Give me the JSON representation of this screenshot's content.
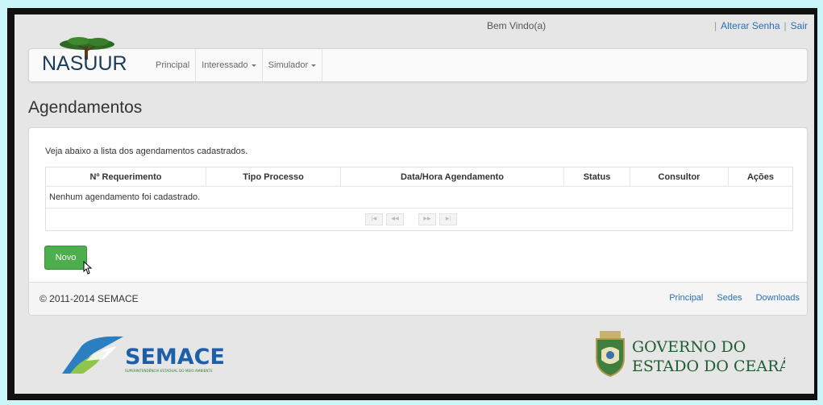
{
  "header": {
    "welcome": "Bem Vindo(a)",
    "links": [
      "Alterar Senha",
      "Sair"
    ]
  },
  "logo": {
    "text": "NASUUR"
  },
  "nav": {
    "items": [
      {
        "label": "Principal",
        "dropdown": false
      },
      {
        "label": "Interessado",
        "dropdown": true
      },
      {
        "label": "Simulador",
        "dropdown": true
      }
    ]
  },
  "page": {
    "title": "Agendamentos"
  },
  "panel": {
    "intro": "Veja abaixo a lista dos agendamentos cadastrados.",
    "table": {
      "headers": [
        "Nº Requerimento",
        "Tipo Processo",
        "Data/Hora Agendamento",
        "Status",
        "Consultor",
        "Ações"
      ],
      "empty_message": "Nenhum agendamento foi cadastrado."
    },
    "new_button": "Novo"
  },
  "footer": {
    "copyright": "© 2011-2014 SEMACE",
    "links": [
      "Principal",
      "Sedes",
      "Downloads"
    ]
  },
  "logos": {
    "semace": "SEMACE",
    "semace_sub": "SUPERINTENDÊNCIA ESTADUAL DO MEIO AMBIENTE",
    "governo_line1": "GOVERNO DO",
    "governo_line2": "ESTADO DO CEARÁ"
  },
  "colors": {
    "accent": "#2a6fb5",
    "success": "#4cae4c",
    "brand_green": "#2e6e3a"
  }
}
